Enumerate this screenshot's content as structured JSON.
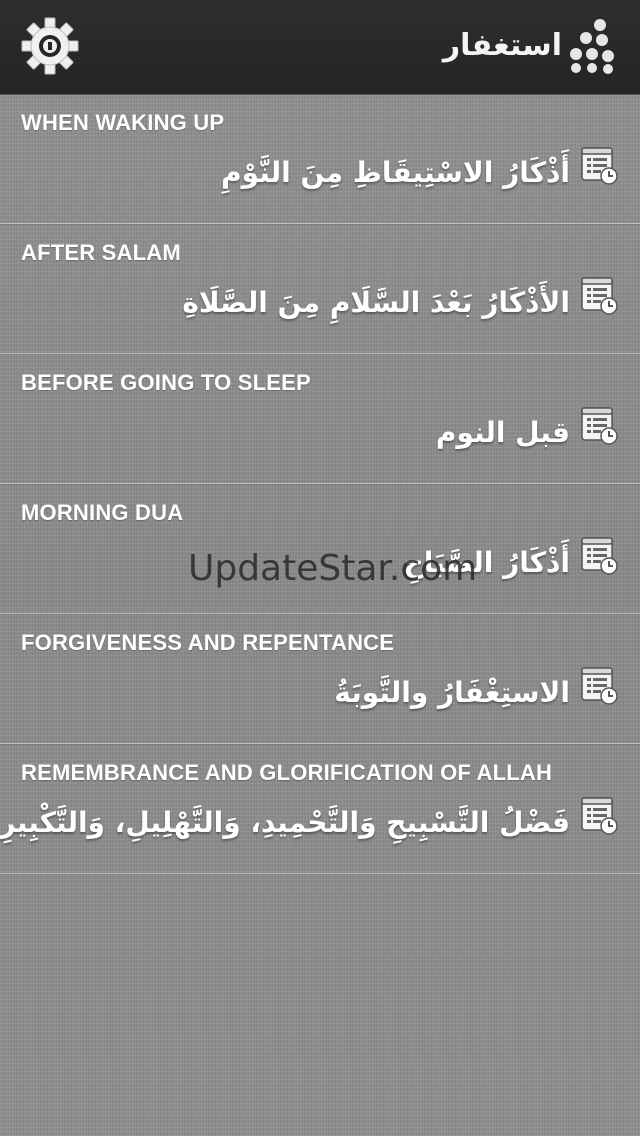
{
  "header": {
    "title": "استغفار",
    "settings_icon": "gear-icon",
    "logo_icon": "dots-logo-icon"
  },
  "items": [
    {
      "en": "WHEN WAKING UP",
      "ar": "أَذْكَارُ الاسْتِيقَاظِ مِنَ النَّوْمِ",
      "icon": "list-clock-icon"
    },
    {
      "en": "AFTER SALAM",
      "ar": "الأَذْكَارُ بَعْدَ السَّلَامِ مِنَ الصَّلَاةِ",
      "icon": "list-clock-icon"
    },
    {
      "en": "BEFORE GOING TO SLEEP",
      "ar": "قبل النوم",
      "icon": "list-clock-icon"
    },
    {
      "en": "MORNING DUA",
      "ar": "أَذْكَارُ الصَّبَاحِ",
      "icon": "list-clock-icon"
    },
    {
      "en": "FORGIVENESS AND REPENTANCE",
      "ar": "الاستِغْفَارُ والتَّوبَةُ",
      "icon": "list-clock-icon"
    },
    {
      "en": "REMEMBRANCE AND GLORIFICATION OF ALLAH",
      "ar": "فَضْلُ التَّسْبِيحِ وَالتَّحْمِيدِ، وَالتَّهْلِيلِ، وَالتَّكْبِيرِ",
      "icon": "list-clock-icon"
    }
  ],
  "watermark": "UpdateStar.com",
  "colors": {
    "header_bg": "#262626",
    "body_bg": "#8c8c8c",
    "text": "#ffffff"
  }
}
